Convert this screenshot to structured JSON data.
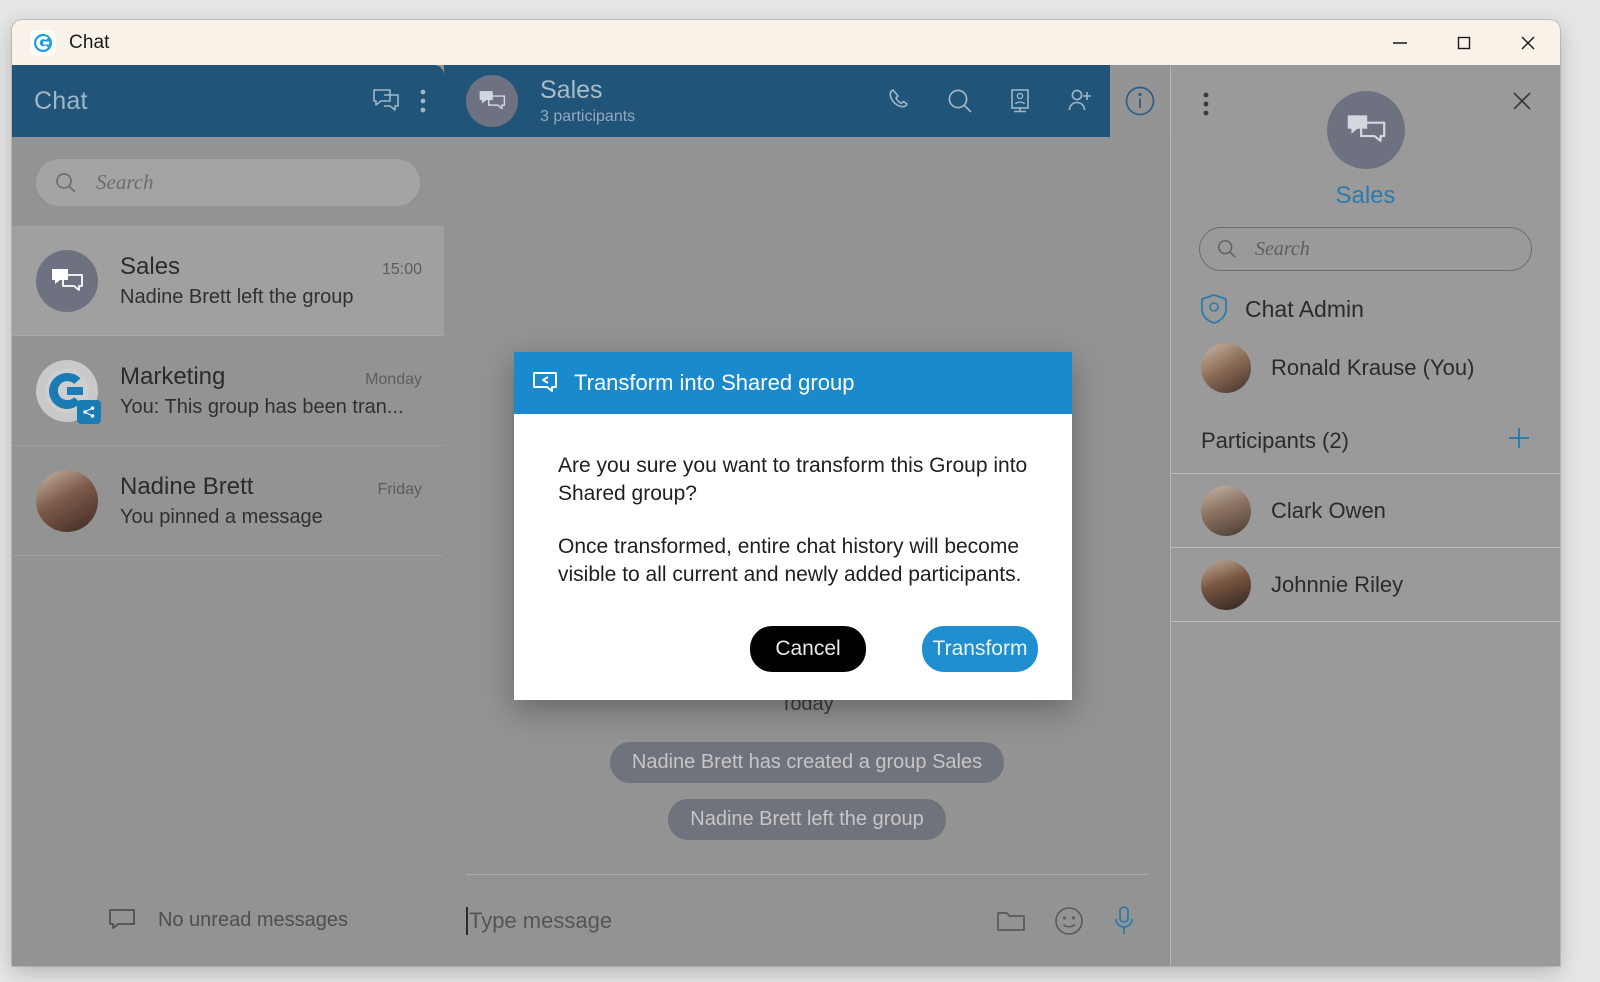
{
  "window": {
    "title": "Chat",
    "logo_icon": "bitrix-logo-icon",
    "minimize_label": "—",
    "maximize_label": "□",
    "close_label": "✕"
  },
  "sidebar": {
    "title": "Chat",
    "new_chat_icon": "new-chat-icon",
    "menu_icon": "kebab-menu-icon",
    "search": {
      "placeholder": "Search",
      "value": "",
      "icon": "search-icon"
    },
    "chats": [
      {
        "name": "Sales",
        "time": "15:00",
        "preview": "Nadine Brett left the group",
        "avatar": "group-chat-icon",
        "selected": true
      },
      {
        "name": "Marketing",
        "time": "Monday",
        "preview": "You: This group has been tran...",
        "avatar": "brand-logo-avatar",
        "badge": "shared-group-badge",
        "selected": false
      },
      {
        "name": "Nadine Brett",
        "time": "Friday",
        "preview": "You pinned a message",
        "avatar": "photo-avatar",
        "selected": false
      }
    ],
    "footer": {
      "text": "No unread messages",
      "icon": "message-bubble-icon"
    }
  },
  "chat_header": {
    "title": "Sales",
    "subtitle": "3 participants",
    "avatar_icon": "group-chat-icon",
    "actions": [
      {
        "name": "call-button",
        "icon": "phone-icon"
      },
      {
        "name": "search-button",
        "icon": "search-icon"
      },
      {
        "name": "videocall-button",
        "icon": "video-device-icon"
      },
      {
        "name": "add-user-button",
        "icon": "add-user-icon"
      },
      {
        "name": "info-button",
        "icon": "info-icon",
        "active": true
      }
    ]
  },
  "conversation": {
    "day_separator": "Today",
    "system_messages": [
      "Nadine Brett has created a group Sales",
      "Nadine Brett left the group"
    ]
  },
  "composer": {
    "placeholder": "Type message",
    "value": "",
    "icons": [
      {
        "name": "attach-file-icon",
        "glyph": "folder-icon"
      },
      {
        "name": "emoji-icon",
        "glyph": "smiley-icon"
      },
      {
        "name": "voice-message-icon",
        "glyph": "microphone-icon"
      }
    ]
  },
  "right_panel": {
    "menu_icon": "kebab-menu-icon",
    "close_icon": "close-icon",
    "avatar_icon": "group-chat-icon",
    "group_name": "Sales",
    "search": {
      "placeholder": "Search",
      "value": "",
      "icon": "search-icon"
    },
    "admin_section": {
      "label": "Chat Admin",
      "icon": "shield-user-icon",
      "admin_name": "Ronald Krause (You)"
    },
    "participants_title": "Participants (2)",
    "add_participant_icon": "plus-icon",
    "participants": [
      {
        "name": "Clark Owen"
      },
      {
        "name": "Johnnie Riley"
      }
    ]
  },
  "modal": {
    "icon": "shared-group-icon",
    "title": "Transform into Shared group",
    "paragraph1": "Are you sure you want to transform this Group into Shared group?",
    "paragraph2": "Once transformed, entire chat history will become visible to all current and newly added participants.",
    "cancel_label": "Cancel",
    "confirm_label": "Transform"
  },
  "colors": {
    "header_blue": "#215479",
    "modal_blue": "#1a8acd",
    "accent_blue": "#2d7bab",
    "titlebar_cream": "#f9f2e8",
    "overlay_gray": "#939393",
    "cancel_black": "#000000"
  }
}
